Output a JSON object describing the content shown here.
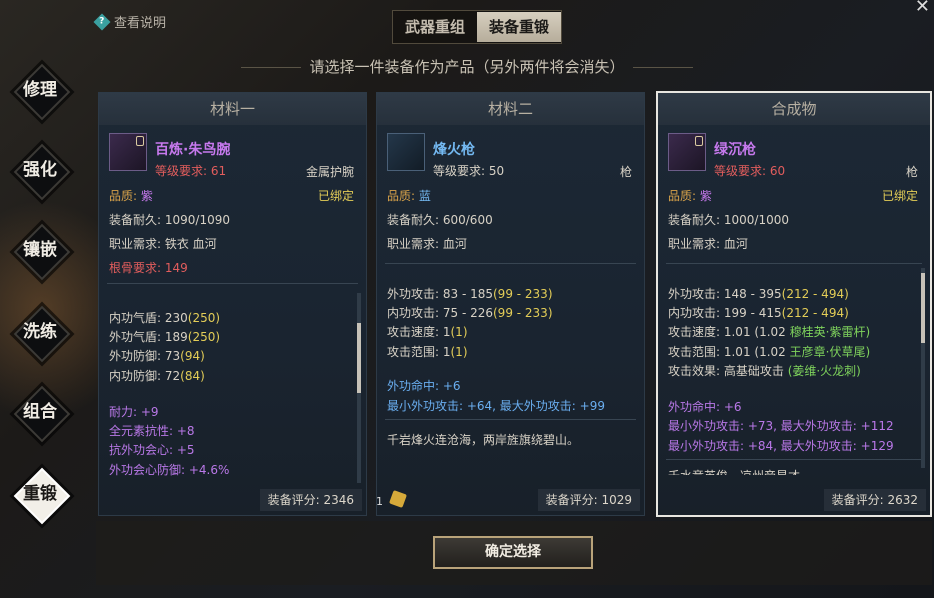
{
  "help_label": "查看说明",
  "tabs": [
    "武器重组",
    "装备重锻"
  ],
  "subtitle": "请选择一件装备作为产品（另外两件将会消失）",
  "nav": [
    "修理",
    "强化",
    "镶嵌",
    "洗练",
    "组合",
    "重锻"
  ],
  "panels": [
    {
      "header": "材料一",
      "name": "百炼·朱鸟腕",
      "level_req": "等级要求: 61",
      "type": "金属护腕",
      "quality_label": "品质:",
      "quality": "紫",
      "bound": "已绑定",
      "durability": "装备耐久: 1090/1090",
      "job": "职业需求: 铁衣 血河",
      "bone_req": "根骨要求: 149",
      "stats": [
        {
          "k": "内功气盾: 230",
          "v": "(250)"
        },
        {
          "k": "外功气盾: 189",
          "v": "(250)"
        },
        {
          "k": "外功防御: 73",
          "v": "(94)"
        },
        {
          "k": "内功防御: 72",
          "v": "(84)"
        }
      ],
      "extras": [
        "耐力: +9",
        "全元素抗性: +8",
        "抗外功会心: +5",
        "外功会心防御: +4.6%"
      ],
      "score": "装备评分: 2346"
    },
    {
      "header": "材料二",
      "name": "烽火枪",
      "level_req": "等级要求: 50",
      "type": "枪",
      "quality_label": "品质:",
      "quality": "蓝",
      "durability": "装备耐久: 600/600",
      "job": "职业需求: 血河",
      "stats": [
        {
          "k": "外功攻击: 83 - 185",
          "v": "(99 - 233)"
        },
        {
          "k": "内功攻击: 75 - 226",
          "v": "(99 - 233)"
        },
        {
          "k": "攻击速度: 1",
          "v": "(1)"
        },
        {
          "k": "攻击范围: 1",
          "v": "(1)"
        }
      ],
      "extras": [
        "外功命中: +6",
        "最小外功攻击: +64, 最大外功攻击: +99"
      ],
      "flavor": "千岩烽火连沧海，两岸旌旗绕碧山。",
      "score": "装备评分: 1029",
      "count": "1"
    },
    {
      "header": "合成物",
      "name": "绿沉枪",
      "level_req": "等级要求: 60",
      "type": "枪",
      "quality_label": "品质:",
      "quality": "紫",
      "bound": "已绑定",
      "durability": "装备耐久: 1000/1000",
      "job": "职业需求: 血河",
      "stats": [
        {
          "k": "外功攻击: 148 - 395",
          "v": "(212 - 494)"
        },
        {
          "k": "内功攻击: 199 - 415",
          "v": "(212 - 494)"
        },
        {
          "k": "攻击速度: 1.01 (1.02",
          "v": "穆桂英·紫雷杆)"
        },
        {
          "k": "攻击范围: 1.01 (1.02",
          "v": "王彦章·伏草尾)"
        },
        {
          "k": "攻击效果: 高基础攻击",
          "v": "(姜维·火龙刺)"
        }
      ],
      "extras": [
        "外功命中: +6",
        "最小外功攻击: +73, 最大外功攻击: +112",
        "最小外功攻击: +84, 最大外功攻击: +129"
      ],
      "flavor": "千水竞英俊，凉州帝星才",
      "score": "装备评分: 2632"
    }
  ],
  "confirm_label": "确定选择"
}
